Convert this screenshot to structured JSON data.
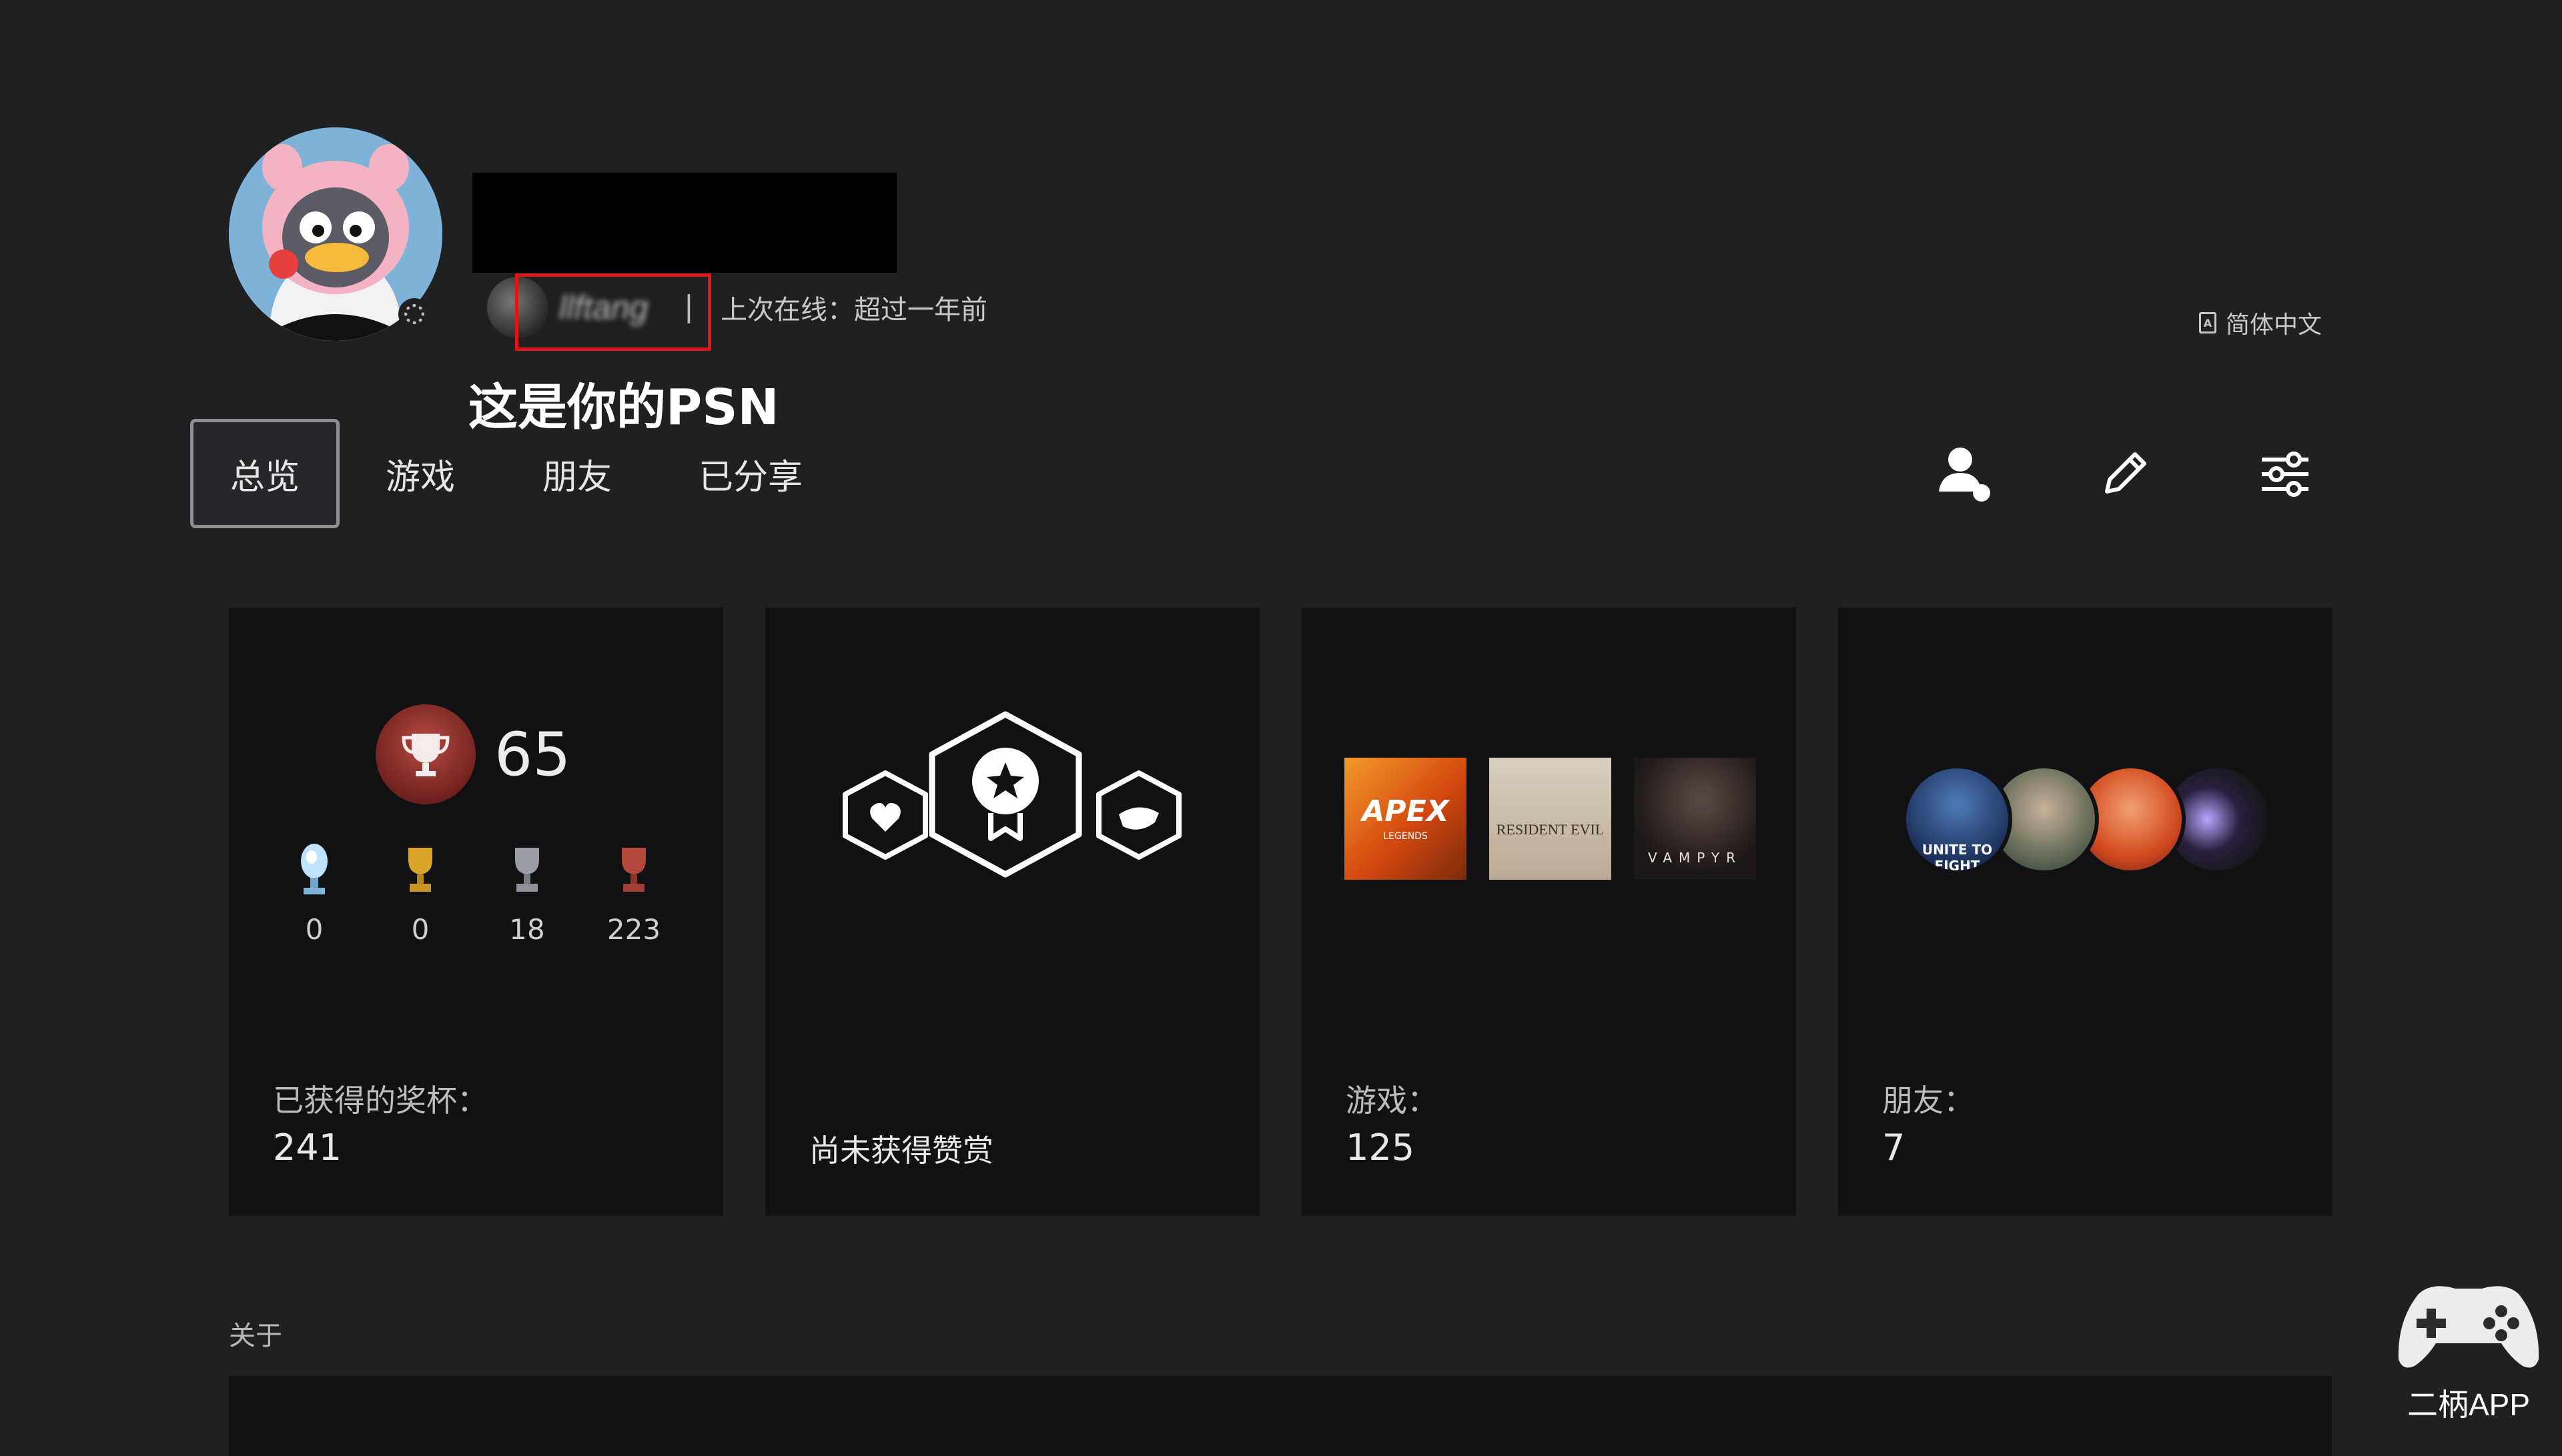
{
  "profile": {
    "online_id": "llftang",
    "separator": "|",
    "last_online": "上次在线：超过一年前",
    "caption": "这是你的PSN",
    "language": "简体中文"
  },
  "tabs": [
    {
      "label": "总览",
      "active": true
    },
    {
      "label": "游戏",
      "active": false
    },
    {
      "label": "朋友",
      "active": false
    },
    {
      "label": "已分享",
      "active": false
    }
  ],
  "actions": [
    "add-friend-icon",
    "edit-icon",
    "settings-sliders-icon"
  ],
  "cards": {
    "trophies": {
      "level": "65",
      "platinum": "0",
      "gold": "0",
      "silver": "18",
      "bronze": "223",
      "label": "已获得的奖杯：",
      "total": "241"
    },
    "praise": {
      "text": "尚未获得赞赏"
    },
    "games": {
      "label": "游戏：",
      "count": "125",
      "covers": [
        {
          "title": "APEX",
          "subtitle": "LEGENDS"
        },
        {
          "title": "RESIDENT EVIL",
          "subtitle": ""
        },
        {
          "title": "VAMPYR",
          "subtitle": ""
        }
      ]
    },
    "friends": {
      "label": "朋友：",
      "count": "7",
      "avatar_text": "UNITE TO FIGHT"
    }
  },
  "about": {
    "label": "关于"
  },
  "watermark": {
    "text": "二柄APP"
  },
  "colors": {
    "background": "#1f2022",
    "card": "#111113",
    "highlight": "#e01515",
    "trophy_red": "#b94b44"
  }
}
